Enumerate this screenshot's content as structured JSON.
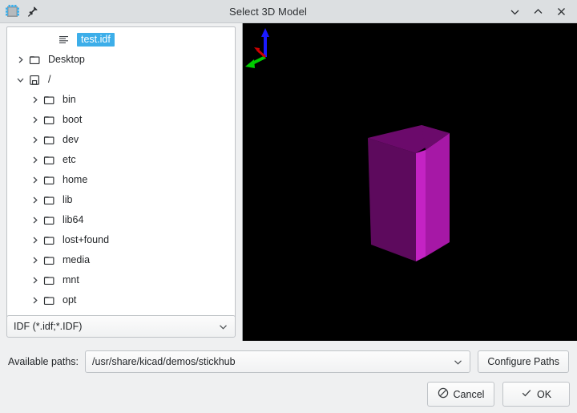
{
  "window": {
    "title": "Select 3D Model",
    "toolbar_icons": [
      {
        "name": "kicad-component-icon"
      },
      {
        "name": "pin-icon"
      }
    ],
    "controls": [
      {
        "name": "minimize-button",
        "icon": "chevron-down-icon"
      },
      {
        "name": "maximize-button",
        "icon": "chevron-up-icon"
      },
      {
        "name": "close-button",
        "icon": "close-icon"
      }
    ]
  },
  "file_tree": {
    "items": [
      {
        "label": "test.idf",
        "icon": "text-file-icon",
        "indent": 2,
        "twisty": "none",
        "selected": true
      },
      {
        "label": "Desktop",
        "icon": "folder-icon",
        "indent": 0,
        "twisty": "right",
        "selected": false
      },
      {
        "label": "/",
        "icon": "drive-icon",
        "indent": 0,
        "twisty": "down",
        "selected": false
      },
      {
        "label": "bin",
        "icon": "folder-icon",
        "indent": 1,
        "twisty": "right",
        "selected": false
      },
      {
        "label": "boot",
        "icon": "folder-icon",
        "indent": 1,
        "twisty": "right",
        "selected": false
      },
      {
        "label": "dev",
        "icon": "folder-icon",
        "indent": 1,
        "twisty": "right",
        "selected": false
      },
      {
        "label": "etc",
        "icon": "folder-icon",
        "indent": 1,
        "twisty": "right",
        "selected": false
      },
      {
        "label": "home",
        "icon": "folder-icon",
        "indent": 1,
        "twisty": "right",
        "selected": false
      },
      {
        "label": "lib",
        "icon": "folder-icon",
        "indent": 1,
        "twisty": "right",
        "selected": false
      },
      {
        "label": "lib64",
        "icon": "folder-icon",
        "indent": 1,
        "twisty": "right",
        "selected": false
      },
      {
        "label": "lost+found",
        "icon": "folder-icon",
        "indent": 1,
        "twisty": "right",
        "selected": false
      },
      {
        "label": "media",
        "icon": "folder-icon",
        "indent": 1,
        "twisty": "right",
        "selected": false
      },
      {
        "label": "mnt",
        "icon": "folder-icon",
        "indent": 1,
        "twisty": "right",
        "selected": false
      },
      {
        "label": "opt",
        "icon": "folder-icon",
        "indent": 1,
        "twisty": "right",
        "selected": false
      }
    ],
    "selection_color": "#3daee9"
  },
  "filter": {
    "value": "IDF (*.idf;*.IDF)"
  },
  "preview": {
    "background": "#000000",
    "model_colors": {
      "front": "#a618a6",
      "top": "#6b0a6b",
      "side": "#c423c4",
      "left": "#5d0a5d"
    },
    "axis_gizmo": {
      "z_color": "#1a1aff",
      "x_color": "#00cc00",
      "y_color": "#cc0000"
    }
  },
  "paths": {
    "label": "Available paths:",
    "value": "/usr/share/kicad/demos/stickhub",
    "configure_button": "Configure Paths"
  },
  "actions": {
    "cancel": "Cancel",
    "ok": "OK"
  }
}
